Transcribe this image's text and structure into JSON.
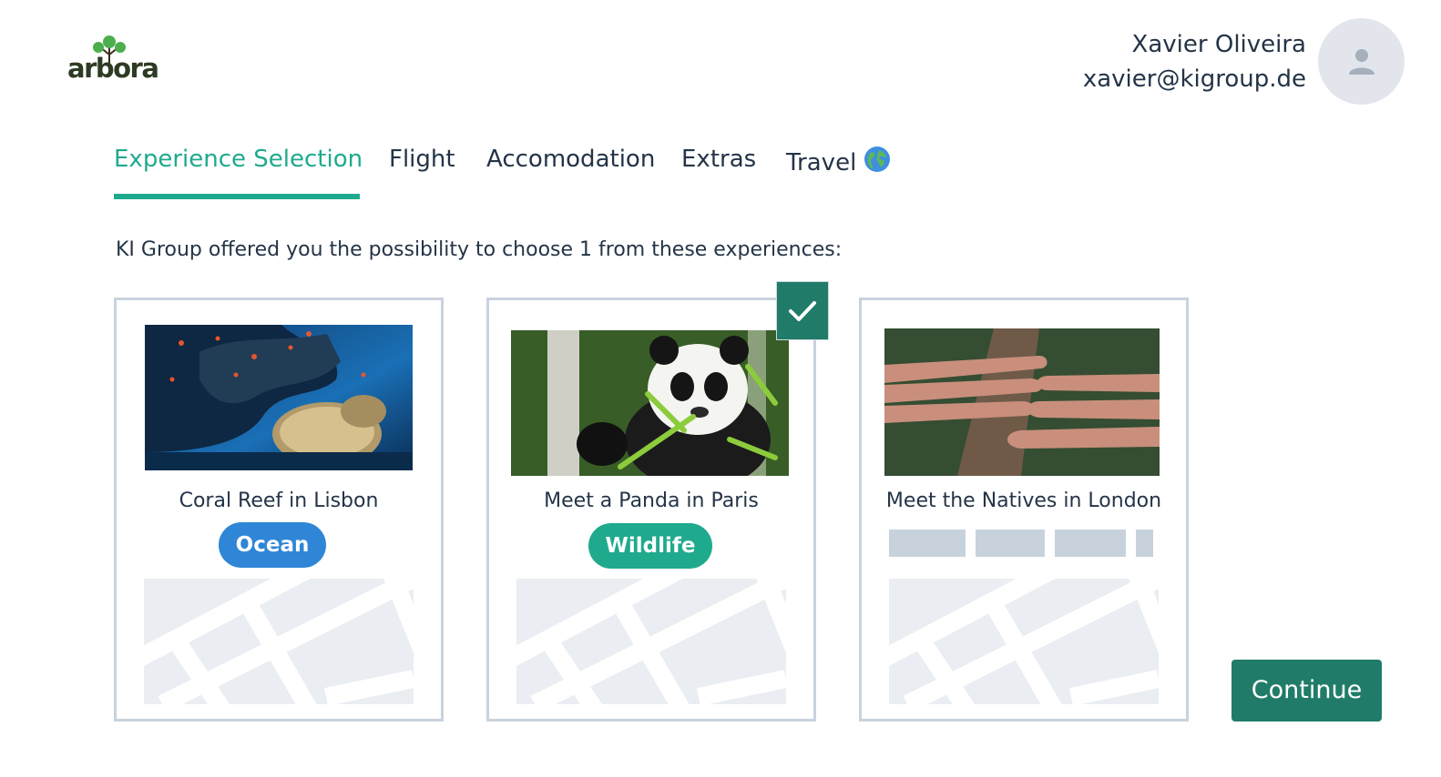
{
  "brand": {
    "logo_text": "arbora"
  },
  "user": {
    "name": "Xavier Oliveira",
    "email": "xavier@kigroup.de"
  },
  "tabs": [
    {
      "label": "Experience Selection",
      "active": true
    },
    {
      "label": "Flight"
    },
    {
      "label": "Accomodation"
    },
    {
      "label": "Extras"
    },
    {
      "label": "Travel",
      "icon": "globe-icon"
    }
  ],
  "intro": "KI Group offered you the possibility to choose 1 from these experiences:",
  "experiences": [
    {
      "title": "Coral Reef in Lisbon",
      "tag": "Ocean",
      "tag_color": "#2f86d6",
      "image": "coral-reef-photo",
      "selected": false
    },
    {
      "title": "Meet a Panda in Paris",
      "tag": "Wildlife",
      "tag_color": "#1faa8e",
      "image": "panda-photo",
      "selected": true
    },
    {
      "title": "Meet the Natives in London",
      "tag": "",
      "image": "hands-on-log-photo",
      "selected": false,
      "tag_loading": true
    }
  ],
  "actions": {
    "continue_label": "Continue"
  },
  "colors": {
    "accent": "#1faa8e",
    "primary_button": "#207c68",
    "card_border": "#c9d3de"
  }
}
